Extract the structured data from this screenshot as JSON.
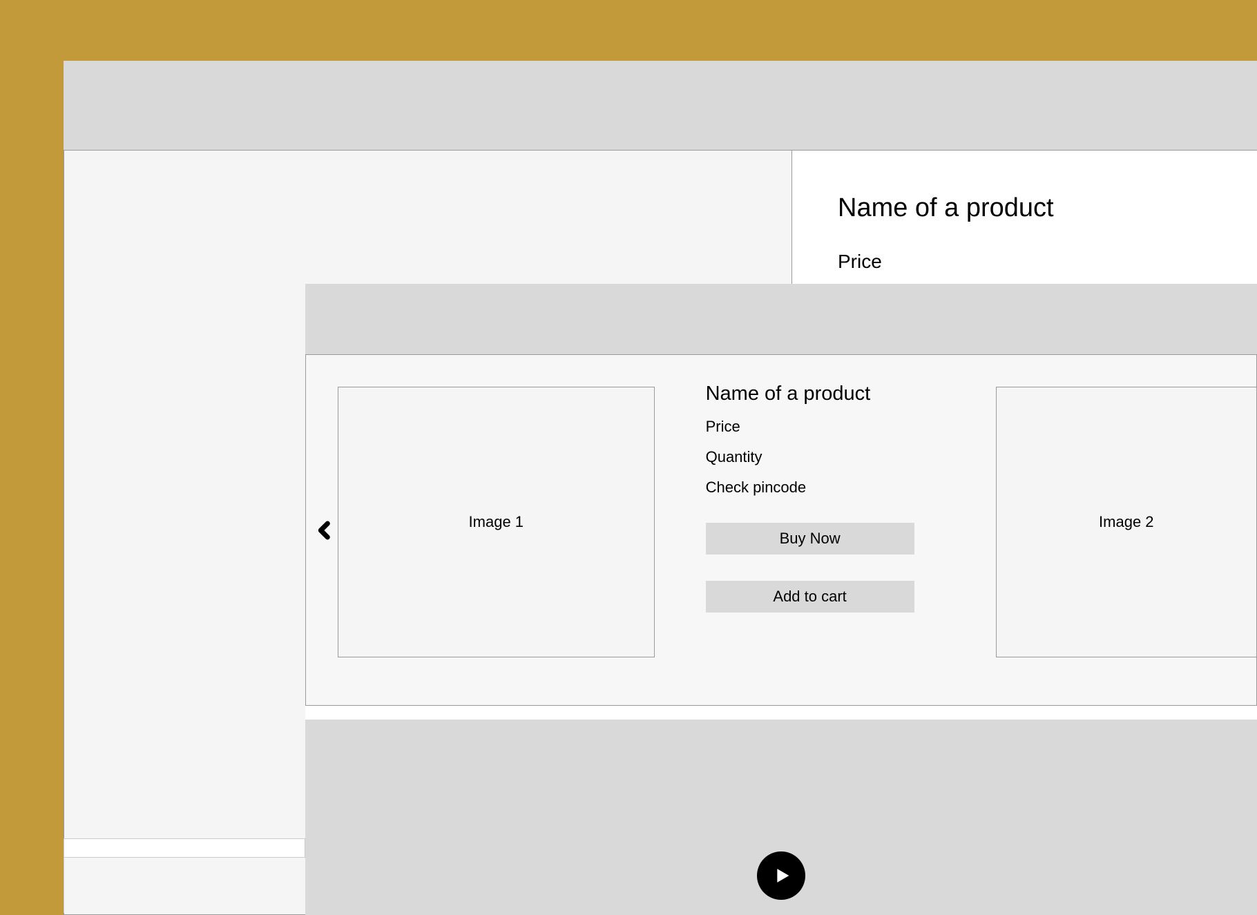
{
  "back": {
    "title": "Name of a product",
    "price": "Price"
  },
  "carousel": {
    "image1_label": "Image 1",
    "image2_label": "Image 2",
    "product": {
      "title": "Name of a product",
      "price": "Price",
      "quantity": "Quantity",
      "pincode": "Check pincode",
      "buy_now": "Buy Now",
      "add_to_cart": "Add to cart"
    }
  }
}
